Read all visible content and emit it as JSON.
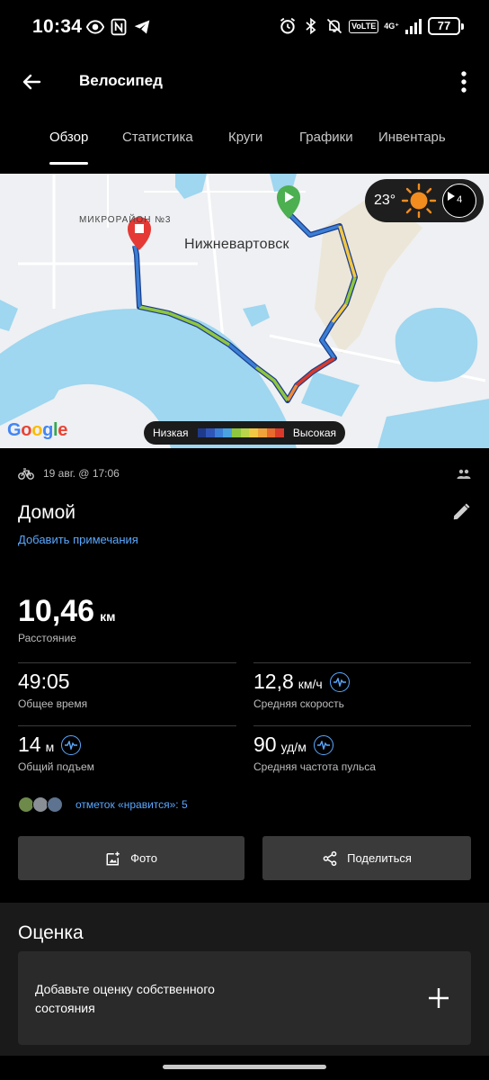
{
  "status": {
    "time": "10:34",
    "volte": "VoLTE",
    "network": "4G⁺",
    "battery": "77"
  },
  "appbar": {
    "title": "Велосипед"
  },
  "tabs": [
    {
      "label": "Обзор",
      "active": true
    },
    {
      "label": "Статистика"
    },
    {
      "label": "Круги"
    },
    {
      "label": "Графики"
    },
    {
      "label": "Инвентарь"
    }
  ],
  "map": {
    "city_label": "Нижневартовск",
    "district_label": "МИКРОРАЙОН №3",
    "google_label": "Google",
    "weather": {
      "temperature": "23°",
      "wind_speed": "4"
    },
    "legend": {
      "low": "Низкая",
      "high": "Высокая"
    },
    "colors": {
      "water": "#9fd6f0",
      "land": "#eef0f3",
      "start": "#4caf50",
      "finish": "#e53935"
    }
  },
  "activity": {
    "date": "19 авг. @ 17:06",
    "name": "Домой",
    "add_note": "Добавить примечания",
    "distance": {
      "value": "10,46",
      "unit": "км",
      "label": "Расстояние"
    },
    "stats": [
      {
        "value": "49:05",
        "unit": "",
        "label": "Общее время"
      },
      {
        "value": "12,8",
        "unit": "км/ч",
        "label": "Средняя скорость"
      },
      {
        "value": "14",
        "unit": "м",
        "label": "Общий подъем"
      },
      {
        "value": "90",
        "unit": "уд/м",
        "label": "Средняя частота пульса"
      }
    ],
    "likes": "отметок «нравится»: 5"
  },
  "buttons": {
    "photo": "Фото",
    "share": "Поделиться"
  },
  "rating": {
    "title": "Оценка",
    "card_text": "Добавьте оценку собственного состояния"
  },
  "icons": [
    "arrow-left-icon",
    "more-vert-icon",
    "bike-icon",
    "people-icon",
    "pencil-icon",
    "pulse-icon",
    "add-photo-icon",
    "share-icon",
    "plus-icon",
    "sun-icon",
    "wind-icon"
  ]
}
